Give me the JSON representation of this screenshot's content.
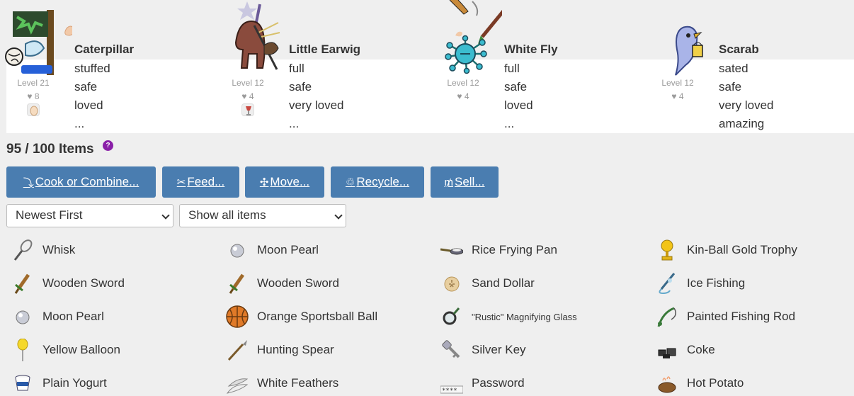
{
  "pets": [
    {
      "name": "Caterpillar",
      "level": "Level 21",
      "hearts": "♥ 8",
      "stats": [
        "stuffed",
        "safe",
        "loved",
        "..."
      ]
    },
    {
      "name": "Little Earwig",
      "level": "Level 12",
      "hearts": "♥ 4",
      "stats": [
        "full",
        "safe",
        "very loved",
        "..."
      ]
    },
    {
      "name": "White Fly",
      "level": "Level 12",
      "hearts": "♥ 4",
      "stats": [
        "full",
        "safe",
        "loved",
        "..."
      ]
    },
    {
      "name": "Scarab",
      "level": "Level 12",
      "hearts": "♥ 4",
      "stats": [
        "sated",
        "safe",
        "very loved",
        "amazing"
      ]
    }
  ],
  "inventory": {
    "count": "95 / 100 Items",
    "help": "?"
  },
  "actions": [
    {
      "label": "Cook or Combine...",
      "icon": "ladle-icon",
      "glyph": "⤵"
    },
    {
      "label": "Feed...",
      "icon": "fork-knife-icon",
      "glyph": "✂"
    },
    {
      "label": "Move...",
      "icon": "move-arrows-icon",
      "glyph": "✣"
    },
    {
      "label": "Recycle...",
      "icon": "recycle-icon",
      "glyph": "♲"
    },
    {
      "label": "Sell...",
      "icon": "moneys-icon",
      "glyph": "₥"
    }
  ],
  "filters": {
    "sort": "Newest First",
    "show": "Show all items"
  },
  "items": [
    {
      "label": "Whisk",
      "icon": "whisk-icon"
    },
    {
      "label": "Moon Pearl",
      "icon": "pearl-icon"
    },
    {
      "label": "Rice Frying Pan",
      "icon": "frying-pan-icon"
    },
    {
      "label": "Kin-Ball Gold Trophy",
      "icon": "trophy-icon"
    },
    {
      "label": "Wooden Sword",
      "icon": "wooden-sword-icon"
    },
    {
      "label": "Wooden Sword",
      "icon": "wooden-sword-icon"
    },
    {
      "label": "Sand Dollar",
      "icon": "sand-dollar-icon"
    },
    {
      "label": "Ice Fishing",
      "icon": "ice-fishing-icon"
    },
    {
      "label": "Moon Pearl",
      "icon": "pearl-icon"
    },
    {
      "label": "Orange Sportsball Ball",
      "icon": "basketball-icon"
    },
    {
      "label": "\"Rustic\" Magnifying Glass",
      "icon": "magnifying-glass-icon"
    },
    {
      "label": "Painted Fishing Rod",
      "icon": "fishing-rod-icon"
    },
    {
      "label": "Yellow Balloon",
      "icon": "balloon-icon"
    },
    {
      "label": "Hunting Spear",
      "icon": "spear-icon"
    },
    {
      "label": "Silver Key",
      "icon": "key-icon"
    },
    {
      "label": "Coke",
      "icon": "coke-icon"
    },
    {
      "label": "Plain Yogurt",
      "icon": "yogurt-icon"
    },
    {
      "label": "White Feathers",
      "icon": "feathers-icon"
    },
    {
      "label": "Password",
      "icon": "password-icon"
    },
    {
      "label": "Hot Potato",
      "icon": "potato-icon"
    }
  ]
}
